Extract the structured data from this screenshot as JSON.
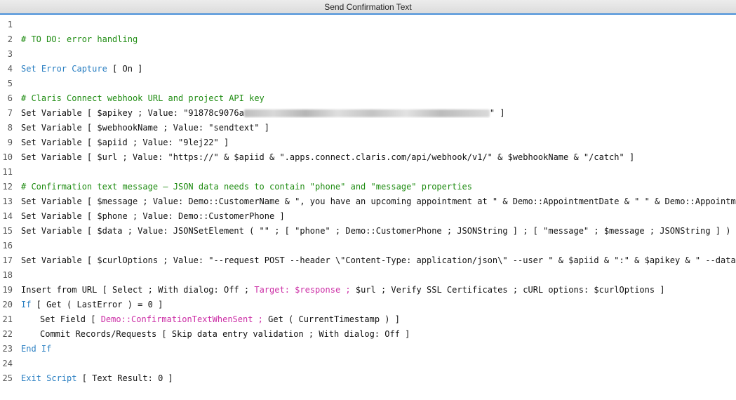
{
  "window": {
    "title": "Send Confirmation Text"
  },
  "lines": [
    {
      "n": "1",
      "parts": []
    },
    {
      "n": "2",
      "parts": [
        {
          "t": "# TO DO: error handling",
          "c": "cmt"
        }
      ]
    },
    {
      "n": "3",
      "parts": []
    },
    {
      "n": "4",
      "parts": [
        {
          "t": "Set Error Capture",
          "c": "kw"
        },
        {
          "t": " [ On ]",
          "c": ""
        }
      ]
    },
    {
      "n": "5",
      "parts": []
    },
    {
      "n": "6",
      "parts": [
        {
          "t": "# Claris Connect webhook URL and project API key",
          "c": "cmt"
        }
      ]
    },
    {
      "n": "7",
      "parts": [
        {
          "t": "Set Variable [ $apikey ; Value: \"91878c9076a",
          "c": ""
        },
        {
          "t": "",
          "c": "redact",
          "redact": true
        },
        {
          "t": "\" ]",
          "c": ""
        }
      ]
    },
    {
      "n": "8",
      "parts": [
        {
          "t": "Set Variable [ $webhookName ; Value: \"sendtext\" ]",
          "c": ""
        }
      ]
    },
    {
      "n": "9",
      "parts": [
        {
          "t": "Set Variable [ $apiid ; Value: \"9lej22\" ]",
          "c": ""
        }
      ]
    },
    {
      "n": "10",
      "parts": [
        {
          "t": "Set Variable [ $url ; Value: \"https://\" & $apiid & \".apps.connect.claris.com/api/webhook/v1/\" & $webhookName & \"/catch\" ]",
          "c": ""
        }
      ]
    },
    {
      "n": "11",
      "parts": []
    },
    {
      "n": "12",
      "parts": [
        {
          "t": "# Confirmation text message – JSON data needs to contain \"phone\" and \"message\" properties",
          "c": "cmt"
        }
      ]
    },
    {
      "n": "13",
      "parts": [
        {
          "t": "Set Variable [ $message ; Value: Demo::CustomerName & \", you have an upcoming appointment at \" & Demo::AppointmentDate & \" \" & Demo::AppointmentTime…  ]",
          "c": ""
        }
      ]
    },
    {
      "n": "14",
      "parts": [
        {
          "t": "Set Variable [ $phone ; Value: Demo::CustomerPhone ]",
          "c": ""
        }
      ]
    },
    {
      "n": "15",
      "parts": [
        {
          "t": "Set Variable [ $data ; Value: JSONSetElement ( \"\" ; [ \"phone\" ; Demo::CustomerPhone ; JSONString ] ; [ \"message\" ; $message ; JSONString ] ) ]",
          "c": ""
        }
      ]
    },
    {
      "n": "16",
      "parts": []
    },
    {
      "n": "17",
      "parts": [
        {
          "t": "Set Variable [ $curlOptions ; Value: \"--request POST --header \\\"Content-Type: application/json\\\" --user \" & $apiid & \":\" & $apikey & \" --data @$data\" ]",
          "c": ""
        }
      ]
    },
    {
      "n": "18",
      "parts": []
    },
    {
      "n": "19",
      "parts": [
        {
          "t": "Insert from URL [ Select ; With dialog: Off ; ",
          "c": ""
        },
        {
          "t": "Target: $response ;",
          "c": "pink"
        },
        {
          "t": " $url ; Verify SSL Certificates ; cURL options: $curlOptions ]",
          "c": ""
        }
      ]
    },
    {
      "n": "20",
      "parts": [
        {
          "t": "If",
          "c": "kw"
        },
        {
          "t": " [ Get ( LastError ) = 0 ]",
          "c": ""
        }
      ]
    },
    {
      "n": "21",
      "indent": true,
      "parts": [
        {
          "t": "Set Field [ ",
          "c": ""
        },
        {
          "t": "Demo::ConfirmationTextWhenSent ;",
          "c": "pink"
        },
        {
          "t": " Get ( CurrentTimestamp ) ]",
          "c": ""
        }
      ]
    },
    {
      "n": "22",
      "indent": true,
      "parts": [
        {
          "t": "Commit Records/Requests [ Skip data entry validation ; With dialog: Off ]",
          "c": ""
        }
      ]
    },
    {
      "n": "23",
      "parts": [
        {
          "t": "End If",
          "c": "kw"
        }
      ]
    },
    {
      "n": "24",
      "parts": []
    },
    {
      "n": "25",
      "parts": [
        {
          "t": "Exit Script",
          "c": "kw"
        },
        {
          "t": " [ Text Result: 0 ]",
          "c": ""
        }
      ]
    }
  ]
}
